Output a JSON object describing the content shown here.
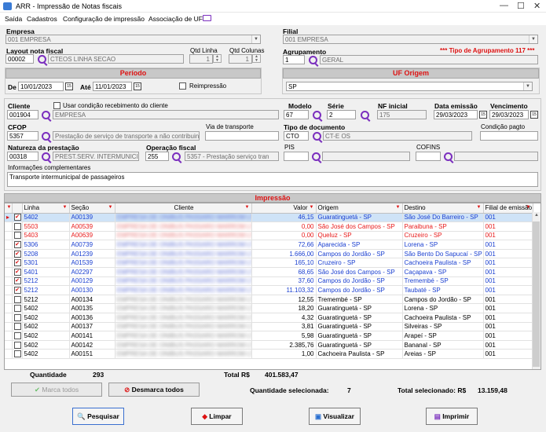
{
  "window": {
    "title": "ARR - Impressão de Notas fiscais"
  },
  "menu": [
    "Saída",
    "Cadastros",
    "Configuração de impressão",
    "Associação de UF"
  ],
  "empresa": {
    "label": "Empresa",
    "value": "001 EMPRESA"
  },
  "filial": {
    "label": "Filial",
    "value": "001 EMPRESA"
  },
  "layout": {
    "label": "Layout nota fiscal",
    "code": "00002",
    "desc": "CTEOS LINHA SECAO"
  },
  "qtd_linha": {
    "label": "Qtd Linha",
    "value": "1"
  },
  "qtd_colunas": {
    "label": "Qtd Colunas",
    "value": "1"
  },
  "agrupamento": {
    "label": "Agrupamento",
    "code": "1",
    "desc": "GERAL",
    "tipo": "*** Tipo de Agrupamento 117 ***"
  },
  "periodo": {
    "title": "Período",
    "de_label": "De",
    "de": "10/01/2023",
    "ate_label": "Até",
    "ate": "11/01/2023",
    "reimpressao": "Reimpressão"
  },
  "uf_origem": {
    "title": "UF Origem",
    "value": "SP"
  },
  "cliente": {
    "label": "Cliente",
    "code": "001904",
    "name": "EMPRESA",
    "usar_cond": "Usar condição recebimento do cliente"
  },
  "modelo": {
    "label": "Modelo",
    "value": "67"
  },
  "serie": {
    "label": "Série",
    "value": "2"
  },
  "nf_inicial": {
    "label": "NF inicial",
    "value": "175"
  },
  "data_emissao": {
    "label": "Data emissão",
    "value": "29/03/2023"
  },
  "vencimento": {
    "label": "Vencimento",
    "value": "29/03/2023"
  },
  "cfop": {
    "label": "CFOP",
    "code": "5357",
    "desc": "Prestação de serviço de transporte a não contribuinte"
  },
  "via_transporte": {
    "label": "Via de transporte",
    "value": ""
  },
  "tipo_documento": {
    "label": "Tipo de documento",
    "code": "CTO",
    "desc": "CT-E OS"
  },
  "condicao_pagto": {
    "label": "Condição pagto",
    "value": ""
  },
  "natureza": {
    "label": "Natureza da prestação",
    "code": "00318",
    "desc": "PREST.SERV. INTERMUNICIPAL"
  },
  "operacao": {
    "label": "Operação fiscal",
    "code": "255",
    "desc": "5357 - Prestação serviço tran"
  },
  "pis": {
    "label": "PIS",
    "value": ""
  },
  "cofins": {
    "label": "COFINS",
    "value": ""
  },
  "info_compl": {
    "label": "Informações complementares",
    "value": "Transporte intermunicipal de passageiros"
  },
  "impressao": {
    "title": "Impressão",
    "columns": [
      "Linha",
      "Seção",
      "Cliente",
      "Valor",
      "Origem",
      "Destino",
      "Filial de emissão"
    ],
    "rows": [
      {
        "checked": true,
        "linha": "5402",
        "secao": "A00139",
        "cliente": "EMPRESA DE ONIBUS PASSARO MARROM LTDA",
        "valor": "46,15",
        "origem": "Guaratinguetá - SP",
        "destino": "São José Do Barreiro - SP",
        "filial": "001",
        "color": "blue",
        "selected": true
      },
      {
        "checked": false,
        "linha": "5503",
        "secao": "A00539",
        "cliente": "EMPRESA DE ONIBUS PASSARO MARROM LTDA",
        "valor": "0,00",
        "origem": "São José dos Campos - SP",
        "destino": "Paraibuna - SP",
        "filial": "001",
        "color": "red"
      },
      {
        "checked": false,
        "linha": "5403",
        "secao": "A00639",
        "cliente": "EMPRESA DE ONIBUS PASSARO MARROM LTDA",
        "valor": "0,00",
        "origem": "Queluz - SP",
        "destino": "Cruzeiro - SP",
        "filial": "001",
        "color": "red"
      },
      {
        "checked": true,
        "linha": "5306",
        "secao": "A00739",
        "cliente": "EMPRESA DE ONIBUS PASSARO MARROM LTDA",
        "valor": "72,66",
        "origem": "Aparecida - SP",
        "destino": "Lorena - SP",
        "filial": "001",
        "color": "blue"
      },
      {
        "checked": true,
        "linha": "5208",
        "secao": "A01239",
        "cliente": "EMPRESA DE ONIBUS PASSARO MARROM LTDA",
        "valor": "1.666,00",
        "origem": "Campos do Jordão - SP",
        "destino": "São Bento Do Sapucaí - SP",
        "filial": "001",
        "color": "blue"
      },
      {
        "checked": true,
        "linha": "5301",
        "secao": "A01539",
        "cliente": "EMPRESA DE ONIBUS PASSARO MARROM LTDA",
        "valor": "165,10",
        "origem": "Cruzeiro - SP",
        "destino": "Cachoeira Paulista - SP",
        "filial": "001",
        "color": "blue"
      },
      {
        "checked": true,
        "linha": "5401",
        "secao": "A02297",
        "cliente": "EMPRESA DE ONIBUS PASSARO MARROM LTDA",
        "valor": "68,65",
        "origem": "São José dos Campos - SP",
        "destino": "Caçapava - SP",
        "filial": "001",
        "color": "blue"
      },
      {
        "checked": true,
        "linha": "5212",
        "secao": "A00129",
        "cliente": "EMPRESA DE ONIBUS PASSARO MARROM LTDA",
        "valor": "37,60",
        "origem": "Campos do Jordão - SP",
        "destino": "Tremembé - SP",
        "filial": "001",
        "color": "blue"
      },
      {
        "checked": true,
        "linha": "5212",
        "secao": "A00130",
        "cliente": "EMPRESA DE ONIBUS PASSARO MARROM LTDA",
        "valor": "11.103,32",
        "origem": "Campos do Jordão - SP",
        "destino": "Taubaté - SP",
        "filial": "001",
        "color": "blue"
      },
      {
        "checked": false,
        "linha": "5212",
        "secao": "A00134",
        "cliente": "EMPRESA DE ONIBUS PASSARO MARROM LTDA",
        "valor": "12,55",
        "origem": "Tremembé - SP",
        "destino": "Campos do Jordão - SP",
        "filial": "001",
        "color": "black"
      },
      {
        "checked": false,
        "linha": "5402",
        "secao": "A00135",
        "cliente": "EMPRESA DE ONIBUS PASSARO MARROM LTDA",
        "valor": "18,20",
        "origem": "Guaratinguetá - SP",
        "destino": "Lorena - SP",
        "filial": "001",
        "color": "black"
      },
      {
        "checked": false,
        "linha": "5402",
        "secao": "A00136",
        "cliente": "EMPRESA DE ONIBUS PASSARO MARROM LTDA",
        "valor": "4,32",
        "origem": "Guaratinguetá - SP",
        "destino": "Cachoeira Paulista - SP",
        "filial": "001",
        "color": "black"
      },
      {
        "checked": false,
        "linha": "5402",
        "secao": "A00137",
        "cliente": "EMPRESA DE ONIBUS PASSARO MARROM LTDA",
        "valor": "3,81",
        "origem": "Guaratinguetá - SP",
        "destino": "Silveiras - SP",
        "filial": "001",
        "color": "black"
      },
      {
        "checked": false,
        "linha": "5402",
        "secao": "A00141",
        "cliente": "EMPRESA DE ONIBUS PASSARO MARROM LTDA",
        "valor": "5,98",
        "origem": "Guaratinguetá - SP",
        "destino": "Arapeí - SP",
        "filial": "001",
        "color": "black"
      },
      {
        "checked": false,
        "linha": "5402",
        "secao": "A00142",
        "cliente": "EMPRESA DE ONIBUS PASSARO MARROM LTDA",
        "valor": "2.385,76",
        "origem": "Guaratinguetá - SP",
        "destino": "Bananal - SP",
        "filial": "001",
        "color": "black"
      },
      {
        "checked": false,
        "linha": "5402",
        "secao": "A00151",
        "cliente": "EMPRESA DE ONIBUS PASSARO MARROM LTDA",
        "valor": "1,00",
        "origem": "Cachoeira Paulista - SP",
        "destino": "Areias - SP",
        "filial": "001",
        "color": "black"
      }
    ]
  },
  "footer": {
    "quantidade_label": "Quantidade",
    "quantidade": "293",
    "total_label": "Total R$",
    "total": "401.583,47",
    "qtd_sel_label": "Quantidade selecionada:",
    "qtd_sel": "7",
    "total_sel_label": "Total selecionado: R$",
    "total_sel": "13.159,48"
  },
  "buttons": {
    "marca": "Marca todos",
    "desmarca": "Desmarca todos",
    "pesquisar": "Pesquisar",
    "limpar": "Limpar",
    "visualizar": "Visualizar",
    "imprimir": "Imprimir"
  },
  "colors": {
    "accent_red": "#dd1111",
    "row_blue": "#1a3fd0",
    "row_red": "#e81b1b",
    "selected_row": "#cfe3f7",
    "icon_purple": "#7b2fbe"
  }
}
